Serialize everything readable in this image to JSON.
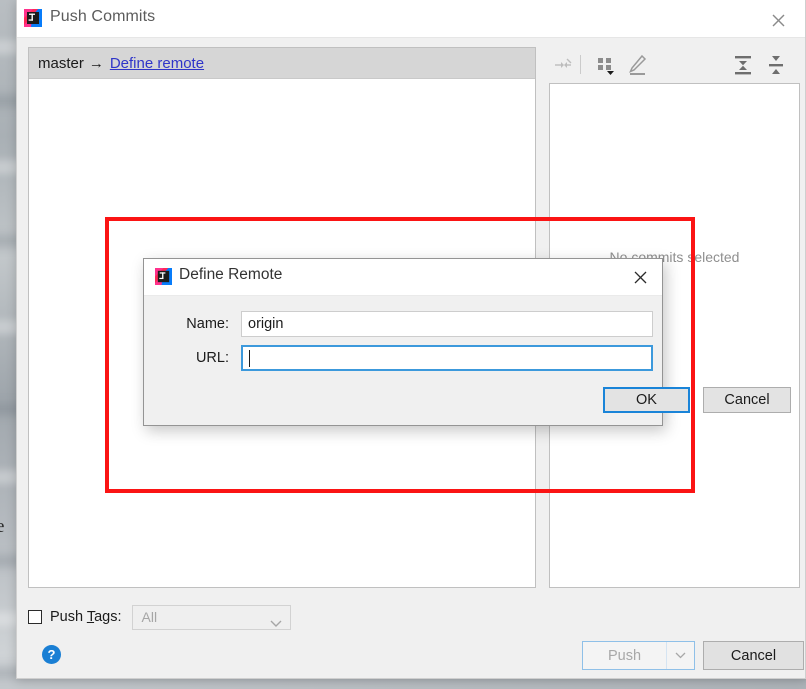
{
  "window": {
    "title": "Push Commits",
    "icon": "intellij-idea-icon",
    "close_icon": "close-icon"
  },
  "commits_panel": {
    "branch": "master",
    "arrow": "→",
    "remote_link": "Define remote"
  },
  "detail_panel": {
    "toolbar": [
      {
        "name": "collapse-selection-icon",
        "label": "Collapse selection"
      },
      {
        "name": "group-by-icon",
        "label": "Group by"
      },
      {
        "name": "edit-icon",
        "label": "Edit"
      },
      {
        "name": "expand-all-icon",
        "label": "Expand all"
      },
      {
        "name": "collapse-all-icon",
        "label": "Collapse all"
      }
    ],
    "empty_text": "No commits selected"
  },
  "bottom": {
    "push_tags_label_prefix": "Push ",
    "push_tags_label_accel": "T",
    "push_tags_label_suffix": "ags:",
    "push_tags_checked": false,
    "tags_combo_value": "All",
    "tags_combo_arrow": "chevron-down-icon",
    "help_label": "?",
    "push_label": "Push",
    "push_enabled": false,
    "push_dropdown_arrow": "chevron-down-icon",
    "cancel_label": "Cancel"
  },
  "dialog": {
    "title": "Define Remote",
    "icon": "intellij-idea-icon",
    "close_icon": "close-icon",
    "name_label": "Name:",
    "name_value": "origin",
    "url_label": "URL:",
    "url_value": "",
    "ok_label": "OK",
    "cancel_label": "Cancel"
  },
  "annotation": {
    "color": "#fb1414",
    "shape": "rectangle"
  },
  "desktop": {
    "partial_text": "e"
  }
}
